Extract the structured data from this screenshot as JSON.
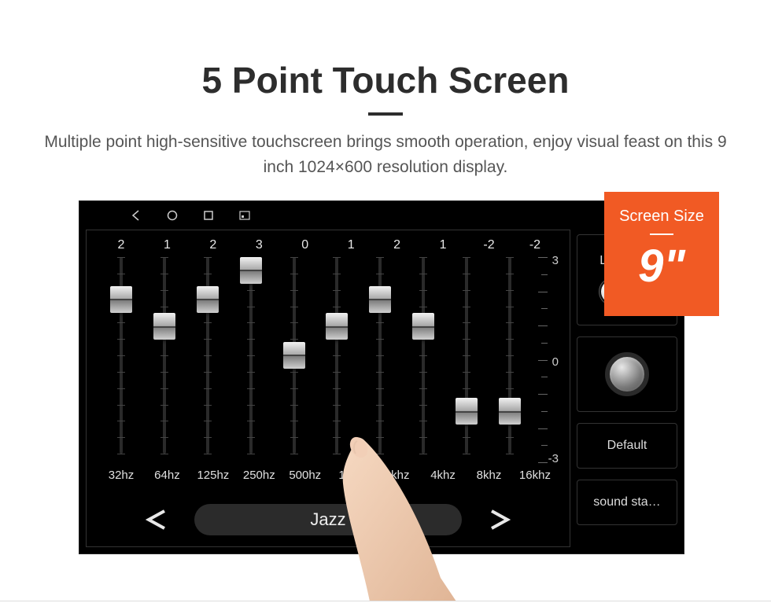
{
  "promo": {
    "title": "5 Point Touch Screen",
    "description": "Multiple point high-sensitive touchscreen brings smooth operation, enjoy visual feast on this 9 inch 1024×600 resolution display."
  },
  "badge": {
    "label": "Screen Size",
    "value": "9\""
  },
  "equalizer": {
    "scale": {
      "max": "3",
      "mid": "0",
      "min": "-3"
    },
    "bands": [
      {
        "value": "2",
        "percent": 17,
        "freq": "32hz"
      },
      {
        "value": "1",
        "percent": 33,
        "freq": "64hz"
      },
      {
        "value": "2",
        "percent": 17,
        "freq": "125hz"
      },
      {
        "value": "3",
        "percent": 0,
        "freq": "250hz"
      },
      {
        "value": "0",
        "percent": 50,
        "freq": "500hz"
      },
      {
        "value": "1",
        "percent": 33,
        "freq": "1khz"
      },
      {
        "value": "2",
        "percent": 17,
        "freq": "2khz"
      },
      {
        "value": "1",
        "percent": 33,
        "freq": "4khz"
      },
      {
        "value": "-2",
        "percent": 83,
        "freq": "8khz"
      },
      {
        "value": "-2",
        "percent": 83,
        "freq": "16khz"
      }
    ],
    "preset": "Jazz"
  },
  "sidePanel": {
    "loudness_label": "Loudness",
    "loudness_on": false,
    "default_label": "Default",
    "sound_stage_label": "sound sta…"
  },
  "colors": {
    "accent_orange": "#f15a24"
  }
}
